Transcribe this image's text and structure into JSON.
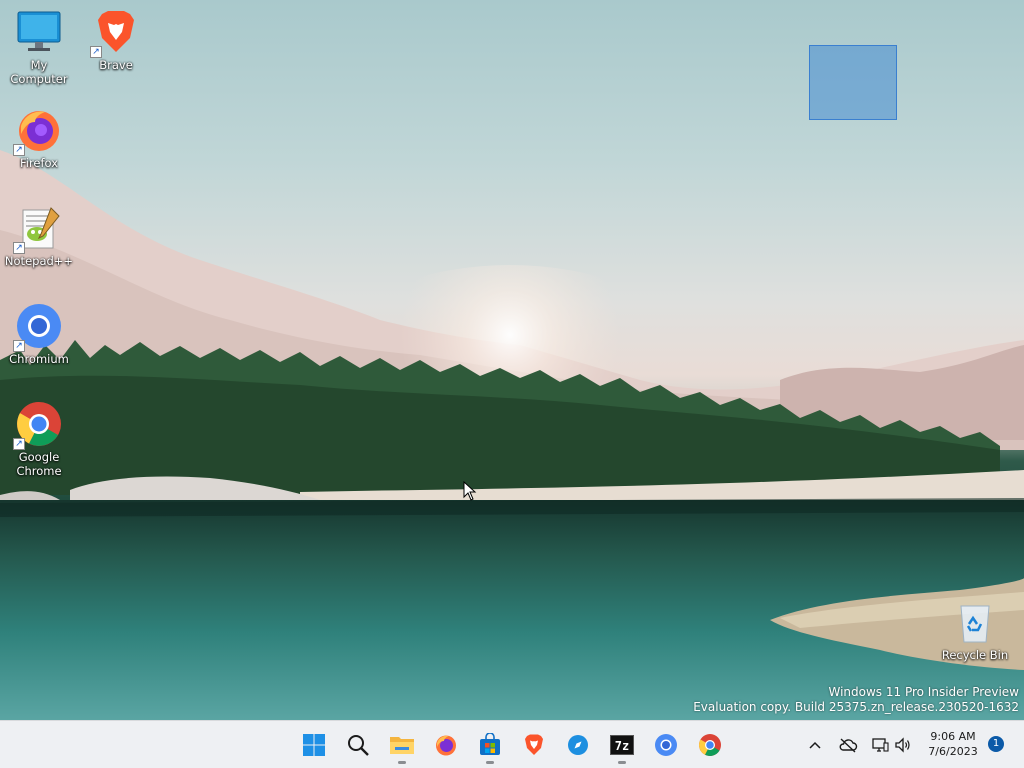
{
  "desktop": {
    "icons": [
      {
        "label": "My Computer",
        "icon": "computer-icon"
      },
      {
        "label": "Brave",
        "icon": "brave-icon"
      },
      {
        "label": "Firefox",
        "icon": "firefox-icon"
      },
      {
        "label": "Notepad++",
        "icon": "notepadpp-icon"
      },
      {
        "label": "Chromium",
        "icon": "chromium-icon"
      },
      {
        "label": "Google Chrome",
        "icon": "chrome-icon"
      },
      {
        "label": "Recycle Bin",
        "icon": "recycle-bin-icon"
      }
    ],
    "watermark": {
      "line1": "Windows 11 Pro Insider Preview",
      "line2": "Evaluation copy. Build 25375.zn_release.230520-1632"
    }
  },
  "taskbar": {
    "apps": [
      {
        "name": "Start",
        "icon": "windows-start-icon"
      },
      {
        "name": "Search",
        "icon": "search-icon"
      },
      {
        "name": "File Explorer",
        "icon": "folder-icon",
        "running": true
      },
      {
        "name": "Firefox",
        "icon": "firefox-icon",
        "running": false
      },
      {
        "name": "Microsoft Store",
        "icon": "store-icon",
        "running": true
      },
      {
        "name": "Brave",
        "icon": "brave-icon"
      },
      {
        "name": "Safari-like",
        "icon": "compass-icon"
      },
      {
        "name": "7-Zip",
        "icon": "7zip-icon",
        "label": "7z",
        "running": true
      },
      {
        "name": "Chromium",
        "icon": "chromium-icon"
      },
      {
        "name": "Google Chrome",
        "icon": "chrome-icon"
      }
    ],
    "tray": {
      "time": "9:06 AM",
      "date": "7/6/2023",
      "notifications": "1"
    }
  },
  "colors": {
    "taskbar_bg": "#eef0f3",
    "accent": "#0b5aa8",
    "selection": "#468cd2"
  }
}
